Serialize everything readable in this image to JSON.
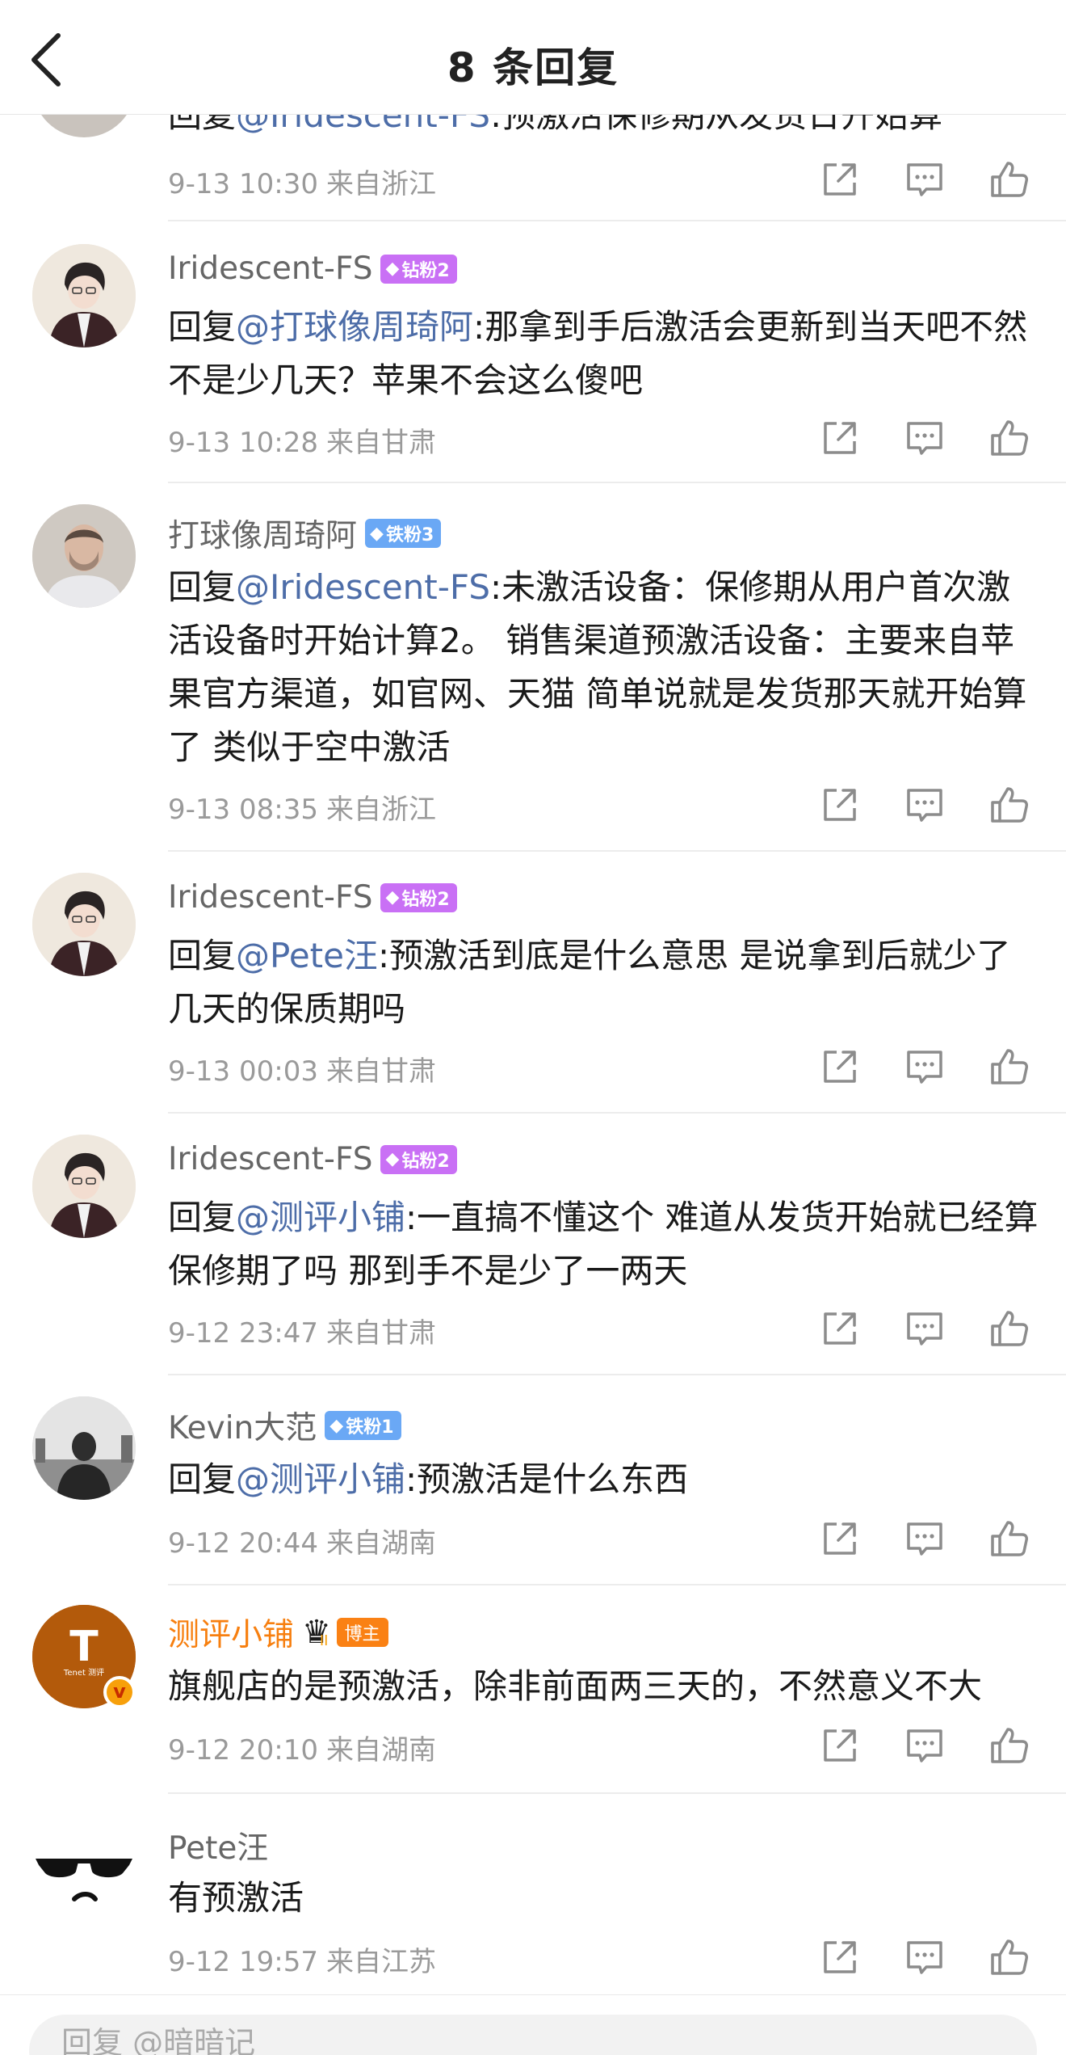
{
  "header": {
    "title": "8 条回复"
  },
  "comments": [
    {
      "username": "",
      "reply_prefix": "回复",
      "mention": "@Iridescent-FS",
      "text": ":预激活保修期从发货日开始算",
      "time": "9-13 10:30",
      "location": "来自浙江"
    },
    {
      "username": "Iridescent-FS",
      "badge": "钻粉2",
      "reply_prefix": "回复",
      "mention": "@打球像周琦阿",
      "text": ":那拿到手后激活会更新到当天吧不然不是少几天？苹果不会这么傻吧",
      "time": "9-13 10:28",
      "location": "来自甘肃"
    },
    {
      "username": "打球像周琦阿",
      "badge": "铁粉3",
      "reply_prefix": "回复",
      "mention": "@Iridescent-FS",
      "text": ":未激活设备：保修期从用户首次激活设备时开始计算2。 销售渠道预激活设备：主要来自苹果官方渠道，如官网、天猫  简单说就是发货那天就开始算了 类似于空中激活",
      "time": "9-13 08:35",
      "location": "来自浙江"
    },
    {
      "username": "Iridescent-FS",
      "badge": "钻粉2",
      "reply_prefix": "回复",
      "mention": "@Pete汪",
      "text": ":预激活到底是什么意思 是说拿到后就少了几天的保质期吗",
      "time": "9-13 00:03",
      "location": "来自甘肃"
    },
    {
      "username": "Iridescent-FS",
      "badge": "钻粉2",
      "reply_prefix": "回复",
      "mention": "@测评小铺",
      "text": ":一直搞不懂这个 难道从发货开始就已经算保修期了吗 那到手不是少了一两天",
      "time": "9-12 23:47",
      "location": "来自甘肃"
    },
    {
      "username": "Kevin大范",
      "badge": "铁粉1",
      "reply_prefix": "回复",
      "mention": "@测评小铺",
      "text": ":预激活是什么东西",
      "time": "9-12 20:44",
      "location": "来自湖南"
    },
    {
      "username": "测评小铺",
      "badge": "博主",
      "crown_level": "II",
      "text": "旗舰店的是预激活，除非前面两三天的，不然意义不大",
      "avatar_letter": "T",
      "avatar_caption": "Tenet 测评",
      "verified_mark": "v",
      "time": "9-12 20:10",
      "location": "来自湖南"
    },
    {
      "username": "Pete汪",
      "text": "有预激活",
      "time": "9-12 19:57",
      "location": "来自江苏"
    }
  ],
  "reply_bar": {
    "placeholder": "回复 @暗暗记"
  },
  "icons": {
    "back": "chevron-left-icon",
    "share": "share-icon",
    "comment": "comment-icon",
    "like": "thumbs-up-icon",
    "gem": "gem-icon"
  },
  "colors": {
    "mention": "#4d6da8",
    "diamond_badge": "#c970f5",
    "iron_badge": "#6aa8f5",
    "blogger": "#f77f0f"
  }
}
